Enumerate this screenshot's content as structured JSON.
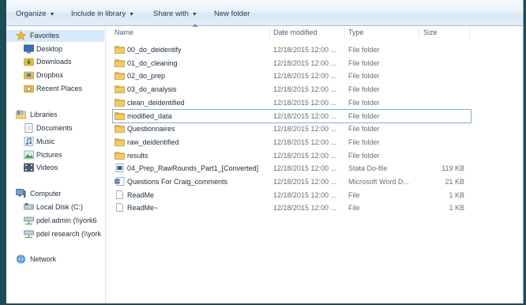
{
  "toolbar": {
    "organize": "Organize",
    "include_in_library": "Include in library",
    "share_with": "Share with",
    "new_folder": "New folder"
  },
  "nav": {
    "favorites": {
      "label": "Favorites",
      "items": [
        "Desktop",
        "Downloads",
        "Dropbox",
        "Recent Places"
      ]
    },
    "libraries": {
      "label": "Libraries",
      "items": [
        "Documents",
        "Music",
        "Pictures",
        "Videos"
      ]
    },
    "computer": {
      "label": "Computer",
      "items": [
        "Local Disk (C:)",
        "pdel admin (\\\\york6",
        "pdel research (\\\\york"
      ]
    },
    "network": {
      "label": "Network"
    }
  },
  "columns": {
    "name": "Name",
    "date": "Date modified",
    "type": "Type",
    "size": "Size"
  },
  "files": [
    {
      "name": "00_do_deidentify",
      "date": "12/18/2015 12:00 ...",
      "type": "File folder",
      "size": "",
      "icon": "folder-icon"
    },
    {
      "name": "01_do_cleaning",
      "date": "12/18/2015 12:00 ...",
      "type": "File folder",
      "size": "",
      "icon": "folder-icon"
    },
    {
      "name": "02_do_prep",
      "date": "12/18/2015 12:00 ...",
      "type": "File folder",
      "size": "",
      "icon": "folder-icon"
    },
    {
      "name": "03_do_analysis",
      "date": "12/18/2015 12:00 ...",
      "type": "File folder",
      "size": "",
      "icon": "folder-icon"
    },
    {
      "name": "clean_deidentified",
      "date": "12/18/2015 12:00 ...",
      "type": "File folder",
      "size": "",
      "icon": "folder-icon"
    },
    {
      "name": "modified_data",
      "date": "12/18/2015 12:00 ...",
      "type": "File folder",
      "size": "",
      "icon": "folder-icon"
    },
    {
      "name": "Questionnaires",
      "date": "12/18/2015 12:00 ...",
      "type": "File folder",
      "size": "",
      "icon": "folder-icon"
    },
    {
      "name": "raw_deidentified",
      "date": "12/18/2015 12:00 ...",
      "type": "File folder",
      "size": "",
      "icon": "folder-icon"
    },
    {
      "name": "results",
      "date": "12/18/2015 12:00 ...",
      "type": "File folder",
      "size": "",
      "icon": "folder-icon"
    },
    {
      "name": "04_Prep_RawRounds_Part1_[Converted]",
      "date": "12/18/2015 12:00 ...",
      "type": "Stata Do-file",
      "size": "119 KB",
      "icon": "stata-file-icon"
    },
    {
      "name": "Questions For Craig_comments",
      "date": "12/18/2015 12:00 ...",
      "type": "Microsoft Word D...",
      "size": "21 KB",
      "icon": "word-doc-icon"
    },
    {
      "name": "ReadMe",
      "date": "12/18/2015 12:00 ...",
      "type": "File",
      "size": "1 KB",
      "icon": "file-icon"
    },
    {
      "name": "ReadMe~",
      "date": "12/18/2015 12:00 ...",
      "type": "File",
      "size": "1 KB",
      "icon": "file-icon"
    }
  ],
  "colors": {
    "desktop_bg": "#1f4a58",
    "folder": "#e8b94a",
    "selection": "#d7e9fb",
    "focus_outline": "#84acdd"
  }
}
